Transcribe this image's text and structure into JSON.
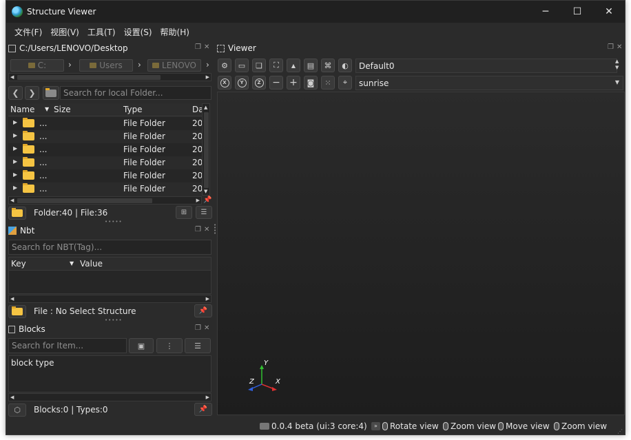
{
  "window": {
    "title": "Structure Viewer"
  },
  "menubar": [
    "文件(F)",
    "视图(V)",
    "工具(T)",
    "设置(S)",
    "帮助(H)"
  ],
  "explorer": {
    "path": "C:/Users/LENOVO/Desktop",
    "breadcrumbs": [
      "C:",
      "Users",
      "LENOVO"
    ],
    "search_placeholder": "Search for local Folder...",
    "columns": [
      "Name",
      "Size",
      "Type",
      "Da"
    ],
    "rows": [
      {
        "name": "...",
        "type": "File Folder",
        "date": "20"
      },
      {
        "name": "...",
        "type": "File Folder",
        "date": "20"
      },
      {
        "name": "...",
        "type": "File Folder",
        "date": "20"
      },
      {
        "name": "...",
        "type": "File Folder",
        "date": "20"
      },
      {
        "name": "...",
        "type": "File Folder",
        "date": "20"
      },
      {
        "name": "...",
        "type": "File Folder",
        "date": "20"
      }
    ],
    "status": "Folder:40 | File:36"
  },
  "nbt": {
    "title": "Nbt",
    "search_placeholder": "Search for NBT(Tag)...",
    "columns": [
      "Key",
      "Value"
    ],
    "status": "File : No Select Structure"
  },
  "blocks": {
    "title": "Blocks",
    "search_placeholder": "Search for Item...",
    "list_item": "block type",
    "status": "Blocks:0 | Types:0"
  },
  "viewer": {
    "title": "Viewer",
    "preset": "Default0",
    "sky": "sunrise",
    "axes": {
      "x": "X",
      "y": "Y",
      "z": "Z"
    },
    "axis_colors": {
      "x": "#e03030",
      "y": "#30c030",
      "z": "#3060e0"
    }
  },
  "statusbar": {
    "version": "0.0.4 beta (ui:3 core:4)",
    "hints": [
      "Rotate view",
      "Zoom view",
      "Move view",
      "Zoom view"
    ]
  }
}
